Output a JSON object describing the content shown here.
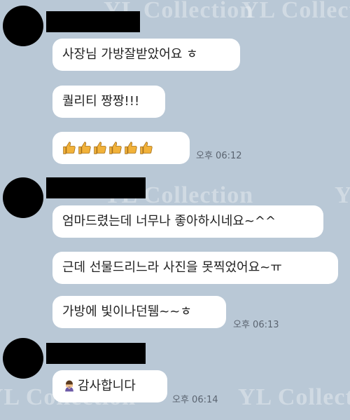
{
  "watermark": "YL Collection",
  "messages": [
    {
      "text": "사장님 가방잘받았어요 ㅎ"
    },
    {
      "text": "퀄리티 짱짱!!!"
    },
    {
      "emoji": "thumbs-up",
      "count": 6,
      "time": "오후 06:12"
    },
    {
      "text": "엄마드렸는데 너무나 좋아하시네요~^^"
    },
    {
      "text": "근데 선물드리느라 사진을 못찍었어요~ㅠ"
    },
    {
      "text": "가방에 빛이나던뒘~~ㅎ",
      "time": "오후 06:13"
    },
    {
      "text": "감사합니다",
      "icon": "bowing-person-icon",
      "time": "오후 06:14"
    }
  ]
}
